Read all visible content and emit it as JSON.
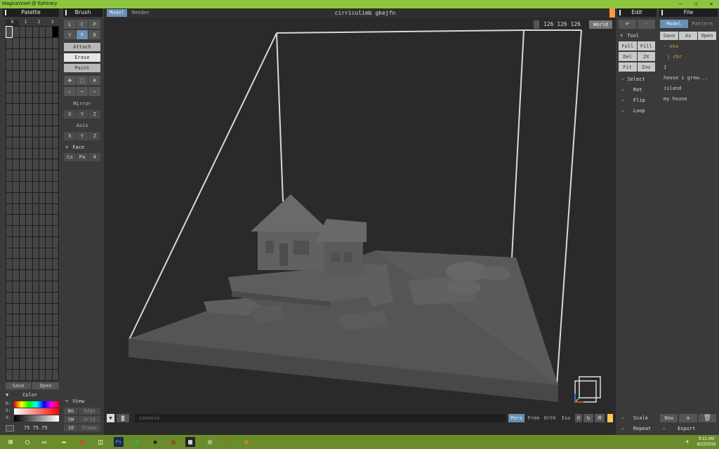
{
  "window": {
    "title": "MagicaVoxel @ Ephtracy",
    "controls": [
      "—",
      "❐",
      "✕"
    ]
  },
  "palette": {
    "title": "Palette",
    "pages": [
      "0",
      "1",
      "2",
      "3"
    ],
    "save_label": "Save",
    "open_label": "Open"
  },
  "color": {
    "title": "Color",
    "h_label": "H:",
    "s_label": "S:",
    "v_label": "V:",
    "rgb": "75 75 75"
  },
  "brush": {
    "title": "Brush",
    "modes_row1": [
      "L",
      "C",
      "P"
    ],
    "modes_row2": [
      "V",
      "F",
      "B"
    ],
    "attach": "Attach",
    "erase": "Erase",
    "paint": "Paint",
    "mirror_label": "Mirror",
    "mirror_axes": [
      "X",
      "Y",
      "Z"
    ],
    "axis_label": "Axis",
    "axis_axes": [
      "X",
      "Y",
      "Z"
    ],
    "face_label": "Face",
    "face_buttons": [
      "Co",
      "Pa",
      "4"
    ]
  },
  "view": {
    "title": "View",
    "rows": [
      {
        "key": "BG",
        "val": "Edge"
      },
      {
        "key": "SW",
        "val": "Grid"
      },
      {
        "key": "10",
        "val": "Frame"
      }
    ]
  },
  "viewport": {
    "tabs": [
      "Model",
      "Render"
    ],
    "scene_name": "cirriculimb gkejfn",
    "dims": "126 126 126",
    "world_label": "World",
    "console_placeholder": "console",
    "cam_modes": [
      "Pers",
      "Free",
      "Orth",
      "Iso"
    ],
    "zero": "0"
  },
  "edit": {
    "title": "Edit",
    "tool_label": "Tool",
    "tools": [
      [
        "Full",
        "Fill"
      ],
      [
        "Del",
        "2X"
      ],
      [
        "Fit",
        "Inv"
      ]
    ],
    "menu": [
      "Select",
      "Rot",
      "Flip",
      "Loop"
    ],
    "bottom": [
      "Scale",
      "Repeat"
    ]
  },
  "file": {
    "title": "File",
    "tabs": [
      "Model",
      "Pattern"
    ],
    "actions": [
      "Save",
      "As",
      "Open"
    ],
    "folder": "- vox",
    "subfolder": "| chr",
    "items": [
      "1",
      "house i grew...",
      "island",
      "my house"
    ],
    "new_label": "New",
    "export_label": "Export"
  },
  "taskbar": {
    "time": "9:21 AM",
    "date": "8/22/2018"
  },
  "colors": {
    "accent": "#6b8fb5",
    "titlebar": "#8cc63f",
    "taskbar": "#6a8c2a",
    "folder": "#e0a040",
    "orange": "#ff9a3c"
  }
}
